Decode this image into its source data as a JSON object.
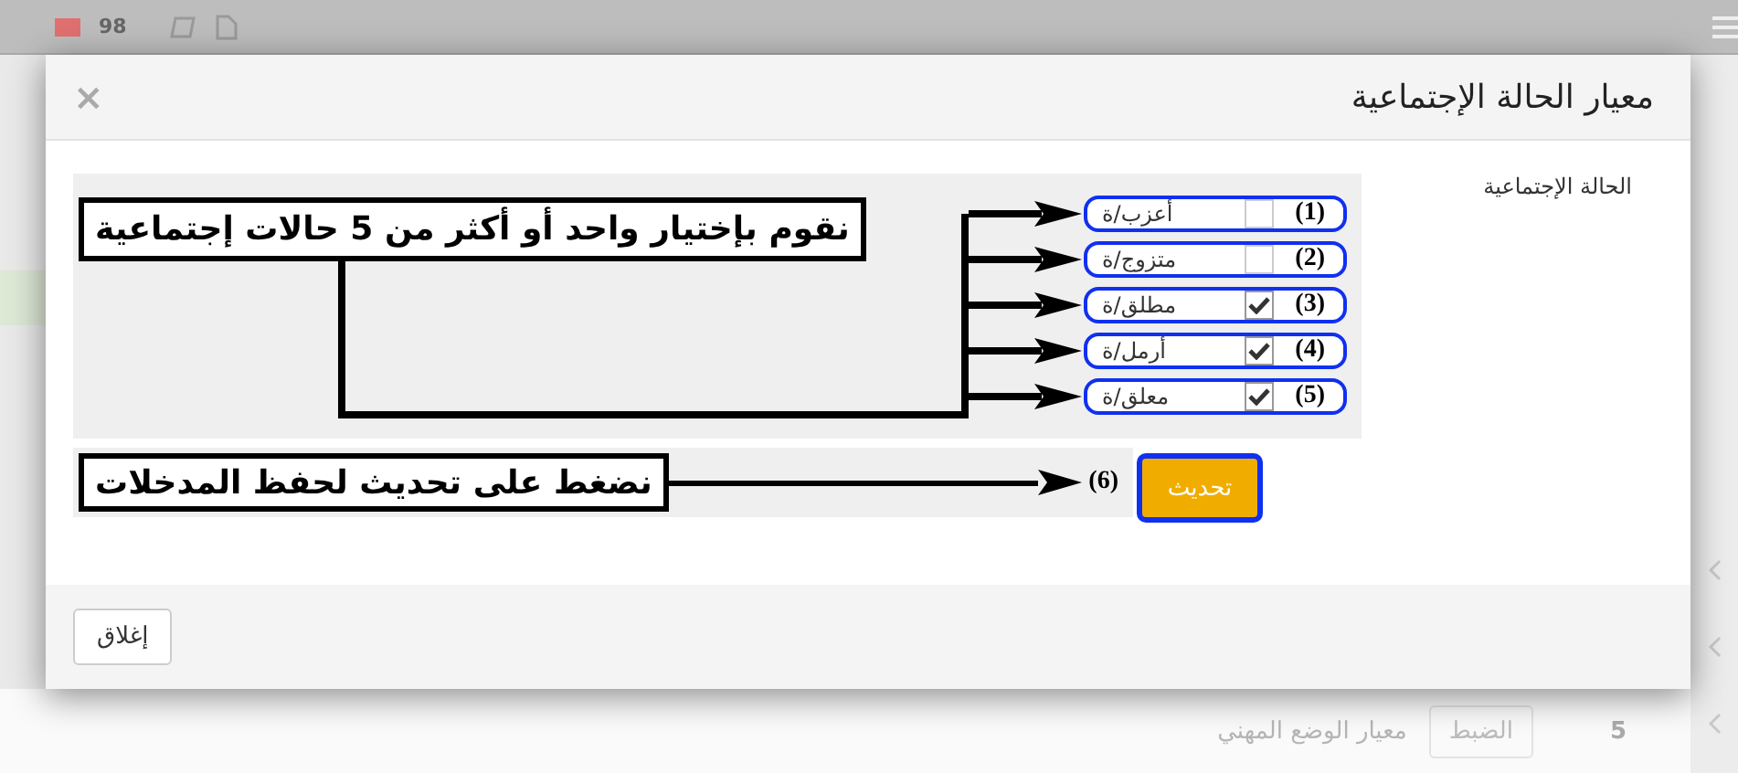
{
  "top_bar": {
    "notification_count": "98"
  },
  "background_row": {
    "number": "5",
    "button": "الضبط",
    "title": "معيار الوضع المهني"
  },
  "dialog": {
    "title": "معيار الحالة الإجتماعية",
    "close_symbol": "×",
    "field_label": "الحالة الإجتماعية",
    "options": [
      {
        "label": "أعزب/ة",
        "checked": false,
        "marker": "(1)"
      },
      {
        "label": "متزوج/ة",
        "checked": false,
        "marker": "(2)"
      },
      {
        "label": "مطلق/ة",
        "checked": true,
        "marker": "(3)"
      },
      {
        "label": "أرمل/ة",
        "checked": true,
        "marker": "(4)"
      },
      {
        "label": "معلق/ة",
        "checked": true,
        "marker": "(5)"
      }
    ],
    "update_button": {
      "label": "تحديث",
      "marker": "(6)"
    },
    "close_button": "إغلاق"
  },
  "annotations": [
    {
      "text": "نقوم بإختيار واحد أو أكثر من 5 حالات إجتماعية"
    },
    {
      "text": "نضغط على تحديث لحفظ المدخلات"
    }
  ]
}
